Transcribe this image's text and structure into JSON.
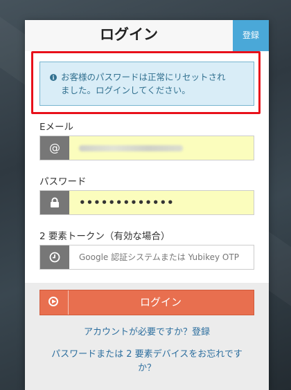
{
  "header": {
    "title": "ログイン",
    "register_label": "登録"
  },
  "alert": {
    "line1": "お客様のパスワードは正常にリセットされ",
    "line2": "ました。ログインしてください。",
    "icon": "info-icon"
  },
  "form": {
    "email": {
      "label": "Eメール",
      "icon": "@"
    },
    "password": {
      "label": "パスワード",
      "value": "•••••••••••••"
    },
    "token": {
      "label": "2 要素トークン（有効な場合）",
      "placeholder": "Google 認証システムまたは Yubikey OTP"
    }
  },
  "login_button": {
    "label": "ログイン"
  },
  "links": {
    "need_account": "アカウントが必要ですか？登録",
    "forgot_line1": "パスワードまたは 2 要素デバイスをお忘れです",
    "forgot_line2": "か？"
  },
  "colors": {
    "accent": "#4aa8d8",
    "login_button": "#e86f4f",
    "alert_bg": "#d9edf7",
    "alert_text": "#31708f",
    "highlight_border": "#e8101a",
    "input_autofill": "#fbfdbd"
  }
}
